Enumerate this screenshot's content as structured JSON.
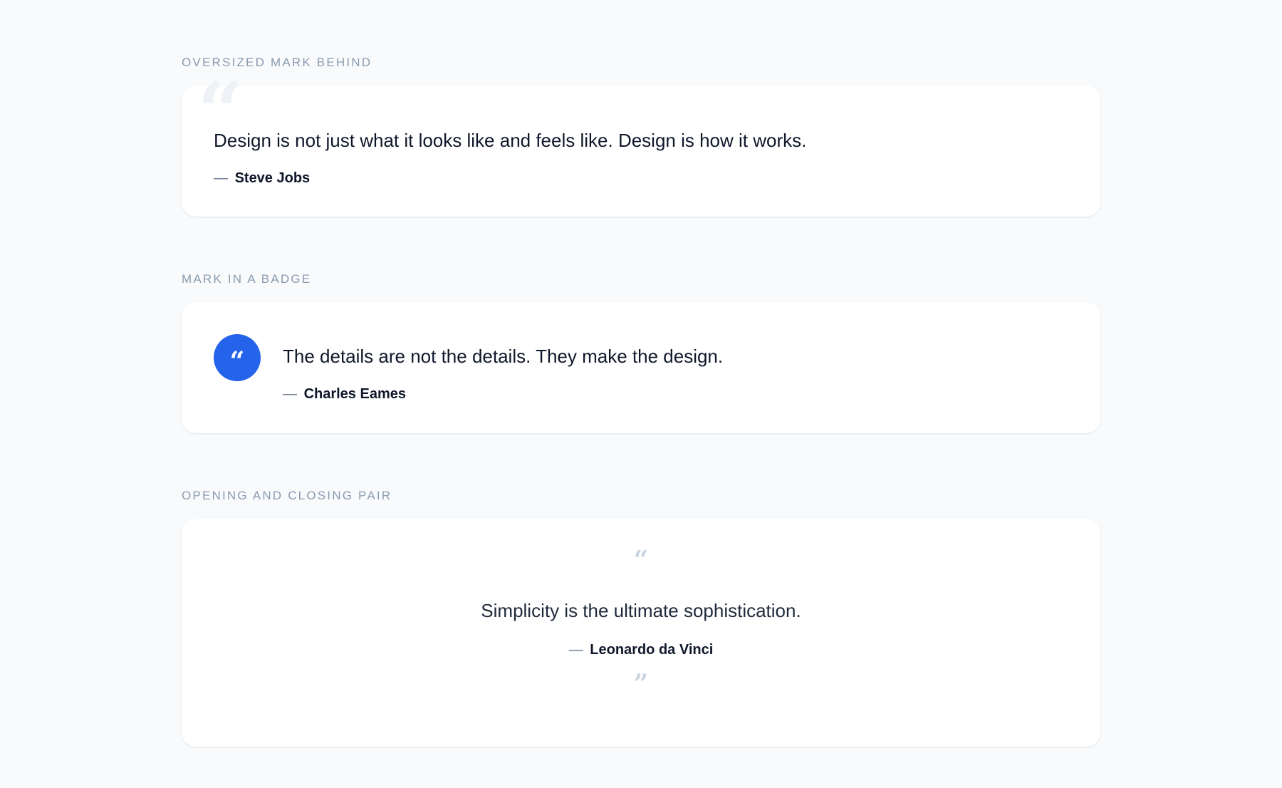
{
  "sections": [
    {
      "label": "OVERSIZED MARK BEHIND",
      "mark": "“",
      "quote": "Design is not just what it looks like and feels like. Design is how it works.",
      "dash": "—",
      "author": "Steve Jobs"
    },
    {
      "label": "MARK IN A BADGE",
      "mark": "“",
      "quote": "The details are not the details. They make the design.",
      "dash": "—",
      "author": "Charles Eames"
    },
    {
      "label": "OPENING AND CLOSING PAIR",
      "open_mark": "“",
      "close_mark": "”",
      "quote": "Simplicity is the ultimate sophistication.",
      "dash": "—",
      "author": "Leonardo da Vinci"
    }
  ],
  "colors": {
    "page_background": "#f8fafc",
    "card_background": "#ffffff",
    "label": "#8b9bb0",
    "text": "#0f172a",
    "badge": "#2563eb",
    "faint_mark": "#eef1f5",
    "pair_mark": "#cbd5e1"
  },
  "icons": {
    "badge_icon": "quote-open-icon",
    "big_mark_icon": "quote-open-icon",
    "open_icon": "quote-open-icon",
    "close_icon": "quote-close-icon"
  }
}
